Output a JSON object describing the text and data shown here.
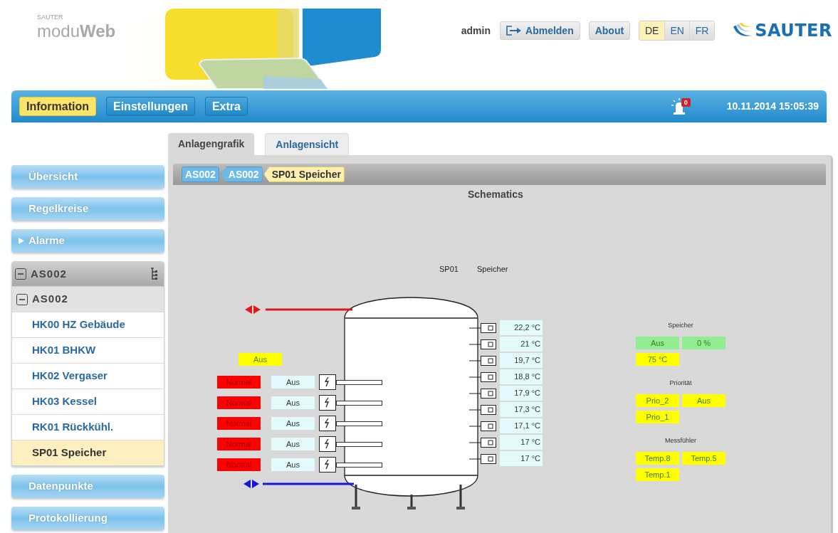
{
  "header": {
    "brand": "SAUTER",
    "product": "modu**Web**",
    "user": "admin",
    "logout": "Abmelden",
    "about": "About",
    "languages": [
      {
        "label": "DE",
        "selected": true
      },
      {
        "label": "EN",
        "selected": false
      },
      {
        "label": "FR",
        "selected": false
      }
    ],
    "logo": "SAUTER"
  },
  "nav": {
    "items": [
      {
        "label": "Information",
        "selected": true
      },
      {
        "label": "Einstellungen",
        "selected": false
      },
      {
        "label": "Extra",
        "selected": false
      }
    ],
    "alarm_count": "0",
    "datetime": "10.11.2014 15:05:39"
  },
  "sidebar": {
    "items": [
      {
        "kind": "button",
        "label": "Übersicht",
        "submenu": false
      },
      {
        "kind": "button",
        "label": "Regelkreise",
        "submenu": false
      },
      {
        "kind": "button",
        "label": "Alarme",
        "submenu": true
      },
      {
        "kind": "tree",
        "label": "AS002",
        "expanded": true,
        "children": [
          {
            "label": "AS002",
            "expanded": true,
            "children": [
              {
                "label": "HK00 HZ Gebäude",
                "selected": false
              },
              {
                "label": "HK01 BHKW",
                "selected": false
              },
              {
                "label": "HK02 Vergaser",
                "selected": false
              },
              {
                "label": "HK03 Kessel",
                "selected": false
              },
              {
                "label": "RK01 Rückkühl.",
                "selected": false
              },
              {
                "label": "SP01 Speicher",
                "selected": true
              }
            ]
          }
        ]
      },
      {
        "kind": "button",
        "label": "Datenpunkte",
        "submenu": false
      },
      {
        "kind": "button",
        "label": "Protokollierung",
        "submenu": false
      }
    ]
  },
  "tabs": [
    {
      "label": "Anlagengrafik",
      "selected": true
    },
    {
      "label": "Anlagensicht",
      "selected": false
    }
  ],
  "breadcrumb": [
    {
      "label": "AS002",
      "selected": false
    },
    {
      "label": "AS002",
      "selected": false
    },
    {
      "label": "SP01 Speicher",
      "selected": true
    }
  ],
  "schematic": {
    "title": "Schematics",
    "device_id": "SP01",
    "device_name": "Speicher",
    "pump_state": "Aus",
    "heaters": [
      {
        "status": "Normal",
        "state": "Aus"
      },
      {
        "status": "Normal",
        "state": "Aus"
      },
      {
        "status": "Normal",
        "state": "Aus"
      },
      {
        "status": "Normal",
        "state": "Aus"
      },
      {
        "status": "Normal",
        "state": "Aus"
      }
    ],
    "sensors": [
      "22,2 °C",
      "21 °C",
      "19,7 °C",
      "18,8 °C",
      "17,9 °C",
      "17,3 °C",
      "17,1 °C",
      "17 °C",
      "17 °C"
    ],
    "groups": [
      {
        "title": "Speicher",
        "fields": [
          {
            "text": "Aus",
            "color": "#90ee90"
          },
          {
            "text": "0 %",
            "color": "#90ee90"
          },
          {
            "text": "75 °C",
            "color": "#ffff00"
          }
        ]
      },
      {
        "title": "Priorität",
        "fields": [
          {
            "text": "Prio_2",
            "color": "#ffff00"
          },
          {
            "text": "Aus",
            "color": "#ffff00"
          },
          {
            "text": "Prio_1",
            "color": "#ffff00"
          }
        ]
      },
      {
        "title": "Messfühler",
        "fields": [
          {
            "text": "Temp.8",
            "color": "#ffff00"
          },
          {
            "text": "Temp.5",
            "color": "#ffff00"
          },
          {
            "text": "Temp.1",
            "color": "#ffff00"
          }
        ]
      }
    ]
  }
}
